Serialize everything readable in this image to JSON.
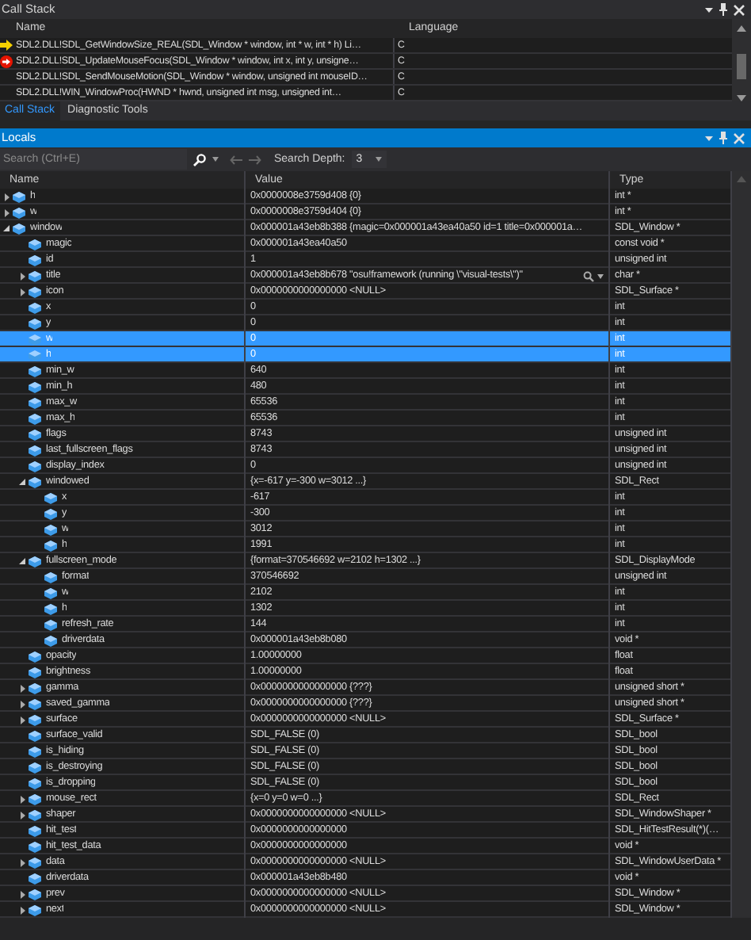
{
  "call_stack": {
    "title": "Call Stack",
    "columns": [
      "Name",
      "Language"
    ],
    "frames": [
      {
        "name": "SDL2.DLL!SDL_GetWindowSize_REAL(SDL_Window * window, int * w, int * h) Li…",
        "language": "C",
        "kind": "current"
      },
      {
        "name": "SDL2.DLL!SDL_UpdateMouseFocus(SDL_Window * window, int x, int y, unsigne…",
        "language": "C",
        "kind": "breakpoint"
      },
      {
        "name": "SDL2.DLL!SDL_SendMouseMotion(SDL_Window * window, unsigned int mouseID…",
        "language": "C",
        "kind": "plain"
      },
      {
        "name": "SDL2.DLL!WIN_WindowProc(HWND * hwnd, unsigned int msg, unsigned int…",
        "language": "C",
        "kind": "plain"
      }
    ]
  },
  "tabs": [
    {
      "label": "Call Stack",
      "selected": true
    },
    {
      "label": "Diagnostic Tools",
      "selected": false
    }
  ],
  "locals": {
    "title": "Locals",
    "search": {
      "placeholder": "Search (Ctrl+E)"
    },
    "depth_label": "Search Depth:",
    "depth": "3",
    "columns": [
      "Name",
      "Value",
      "Type"
    ],
    "items": [
      {
        "name": "h",
        "value": "0x0000008e3759d408 {0}",
        "type": "int *",
        "expanded": false,
        "selected": false
      },
      {
        "name": "w",
        "value": "0x0000008e3759d404 {0}",
        "type": "int *",
        "expanded": false,
        "selected": false
      },
      {
        "name": "window",
        "value": "0x000001a43eb8b388 {magic=0x000001a43ea40a50 id=1 title=0x000001a…",
        "type": "SDL_Window *",
        "expanded": true,
        "selected": false,
        "children": [
          {
            "name": "magic",
            "value": "0x000001a43ea40a50",
            "type": "const void *",
            "selected": false
          },
          {
            "name": "id",
            "value": "1",
            "type": "unsigned int",
            "selected": false
          },
          {
            "name": "title",
            "value": "0x000001a43eb8b678 \"osu!framework (running \\\"visual-tests\\\")\"",
            "type": "char *",
            "expanded": false,
            "selected": false,
            "visualizer": true
          },
          {
            "name": "icon",
            "value": "0x0000000000000000 <NULL>",
            "type": "SDL_Surface *",
            "expanded": false,
            "selected": false
          },
          {
            "name": "x",
            "value": "0",
            "type": "int",
            "selected": false
          },
          {
            "name": "y",
            "value": "0",
            "type": "int",
            "selected": false
          },
          {
            "name": "w",
            "value": "0",
            "type": "int",
            "selected": true
          },
          {
            "name": "h",
            "value": "0",
            "type": "int",
            "selected": true
          },
          {
            "name": "min_w",
            "value": "640",
            "type": "int",
            "selected": false
          },
          {
            "name": "min_h",
            "value": "480",
            "type": "int",
            "selected": false
          },
          {
            "name": "max_w",
            "value": "65536",
            "type": "int",
            "selected": false
          },
          {
            "name": "max_h",
            "value": "65536",
            "type": "int",
            "selected": false
          },
          {
            "name": "flags",
            "value": "8743",
            "type": "unsigned int",
            "selected": false
          },
          {
            "name": "last_fullscreen_flags",
            "value": "8743",
            "type": "unsigned int",
            "selected": false
          },
          {
            "name": "display_index",
            "value": "0",
            "type": "unsigned int",
            "selected": false
          },
          {
            "name": "windowed",
            "value": "{x=-617 y=-300 w=3012 ...}",
            "type": "SDL_Rect",
            "expanded": true,
            "selected": false,
            "children": [
              {
                "name": "x",
                "value": "-617",
                "type": "int",
                "selected": false
              },
              {
                "name": "y",
                "value": "-300",
                "type": "int",
                "selected": false
              },
              {
                "name": "w",
                "value": "3012",
                "type": "int",
                "selected": false
              },
              {
                "name": "h",
                "value": "1991",
                "type": "int",
                "selected": false
              }
            ]
          },
          {
            "name": "fullscreen_mode",
            "value": "{format=370546692 w=2102 h=1302 ...}",
            "type": "SDL_DisplayMode",
            "expanded": true,
            "selected": false,
            "children": [
              {
                "name": "format",
                "value": "370546692",
                "type": "unsigned int",
                "selected": false
              },
              {
                "name": "w",
                "value": "2102",
                "type": "int",
                "selected": false
              },
              {
                "name": "h",
                "value": "1302",
                "type": "int",
                "selected": false
              },
              {
                "name": "refresh_rate",
                "value": "144",
                "type": "int",
                "selected": false
              },
              {
                "name": "driverdata",
                "value": "0x000001a43eb8b080",
                "type": "void *",
                "selected": false
              }
            ]
          },
          {
            "name": "opacity",
            "value": "1.00000000",
            "type": "float",
            "selected": false
          },
          {
            "name": "brightness",
            "value": "1.00000000",
            "type": "float",
            "selected": false
          },
          {
            "name": "gamma",
            "value": "0x0000000000000000 {???}",
            "type": "unsigned short *",
            "expanded": false,
            "selected": false
          },
          {
            "name": "saved_gamma",
            "value": "0x0000000000000000 {???}",
            "type": "unsigned short *",
            "expanded": false,
            "selected": false
          },
          {
            "name": "surface",
            "value": "0x0000000000000000 <NULL>",
            "type": "SDL_Surface *",
            "expanded": false,
            "selected": false
          },
          {
            "name": "surface_valid",
            "value": "SDL_FALSE (0)",
            "type": "SDL_bool",
            "selected": false
          },
          {
            "name": "is_hiding",
            "value": "SDL_FALSE (0)",
            "type": "SDL_bool",
            "selected": false
          },
          {
            "name": "is_destroying",
            "value": "SDL_FALSE (0)",
            "type": "SDL_bool",
            "selected": false
          },
          {
            "name": "is_dropping",
            "value": "SDL_FALSE (0)",
            "type": "SDL_bool",
            "selected": false
          },
          {
            "name": "mouse_rect",
            "value": "{x=0 y=0 w=0 ...}",
            "type": "SDL_Rect",
            "expanded": false,
            "selected": false
          },
          {
            "name": "shaper",
            "value": "0x0000000000000000 <NULL>",
            "type": "SDL_WindowShaper *",
            "expanded": false,
            "selected": false
          },
          {
            "name": "hit_test",
            "value": "0x0000000000000000",
            "type": "SDL_HitTestResult(*)(…",
            "selected": false
          },
          {
            "name": "hit_test_data",
            "value": "0x0000000000000000",
            "type": "void *",
            "selected": false
          },
          {
            "name": "data",
            "value": "0x0000000000000000 <NULL>",
            "type": "SDL_WindowUserData *",
            "expanded": false,
            "selected": false
          },
          {
            "name": "driverdata",
            "value": "0x000001a43eb8b480",
            "type": "void *",
            "selected": false
          },
          {
            "name": "prev",
            "value": "0x0000000000000000 <NULL>",
            "type": "SDL_Window *",
            "expanded": false,
            "selected": false
          },
          {
            "name": "next",
            "value": "0x0000000000000000 <NULL>",
            "type": "SDL_Window *",
            "expanded": false,
            "selected": false
          }
        ]
      }
    ]
  }
}
